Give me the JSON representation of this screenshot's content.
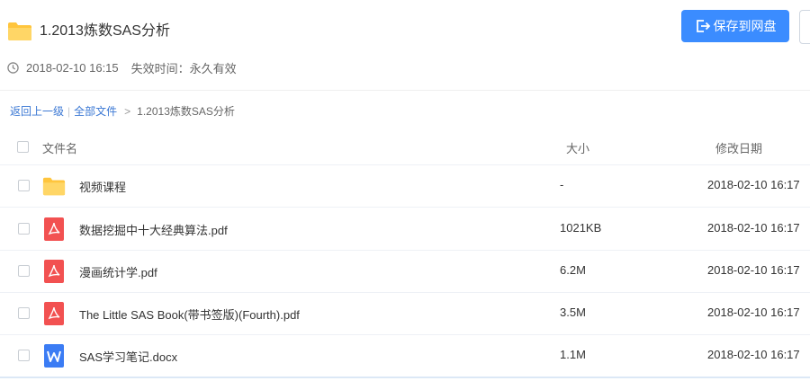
{
  "header": {
    "title": "1.2013炼数SAS分析",
    "save_label": "保存到网盘",
    "date": "2018-02-10 16:15",
    "expire": "失效时间：永久有效"
  },
  "breadcrumb": {
    "back": "返回上一级",
    "separator": "|",
    "all_files": "全部文件",
    "arrow": ">",
    "current": "1.2013炼数SAS分析"
  },
  "table": {
    "col_name": "文件名",
    "col_size": "大小",
    "col_date": "修改日期",
    "rows": [
      {
        "name": "视频课程",
        "size": "-",
        "date": "2018-02-10 16:17",
        "icon": "folder-icon"
      },
      {
        "name": "数据挖掘中十大经典算法.pdf",
        "size": "1021KB",
        "date": "2018-02-10 16:17",
        "icon": "pdf-icon"
      },
      {
        "name": "漫画统计学.pdf",
        "size": "6.2M",
        "date": "2018-02-10 16:17",
        "icon": "pdf-icon"
      },
      {
        "name": "The Little SAS Book(带书签版)(Fourth).pdf",
        "size": "3.5M",
        "date": "2018-02-10 16:17",
        "icon": "pdf-icon"
      },
      {
        "name": "SAS学习笔记.docx",
        "size": "1.1M",
        "date": "2018-02-10 16:17",
        "icon": "word-icon"
      }
    ]
  },
  "colors": {
    "accent": "#3b8cff",
    "folder": "#ffc53d",
    "pdf": "#f25151",
    "word": "#3b7cf4",
    "link": "#3b78d4"
  }
}
